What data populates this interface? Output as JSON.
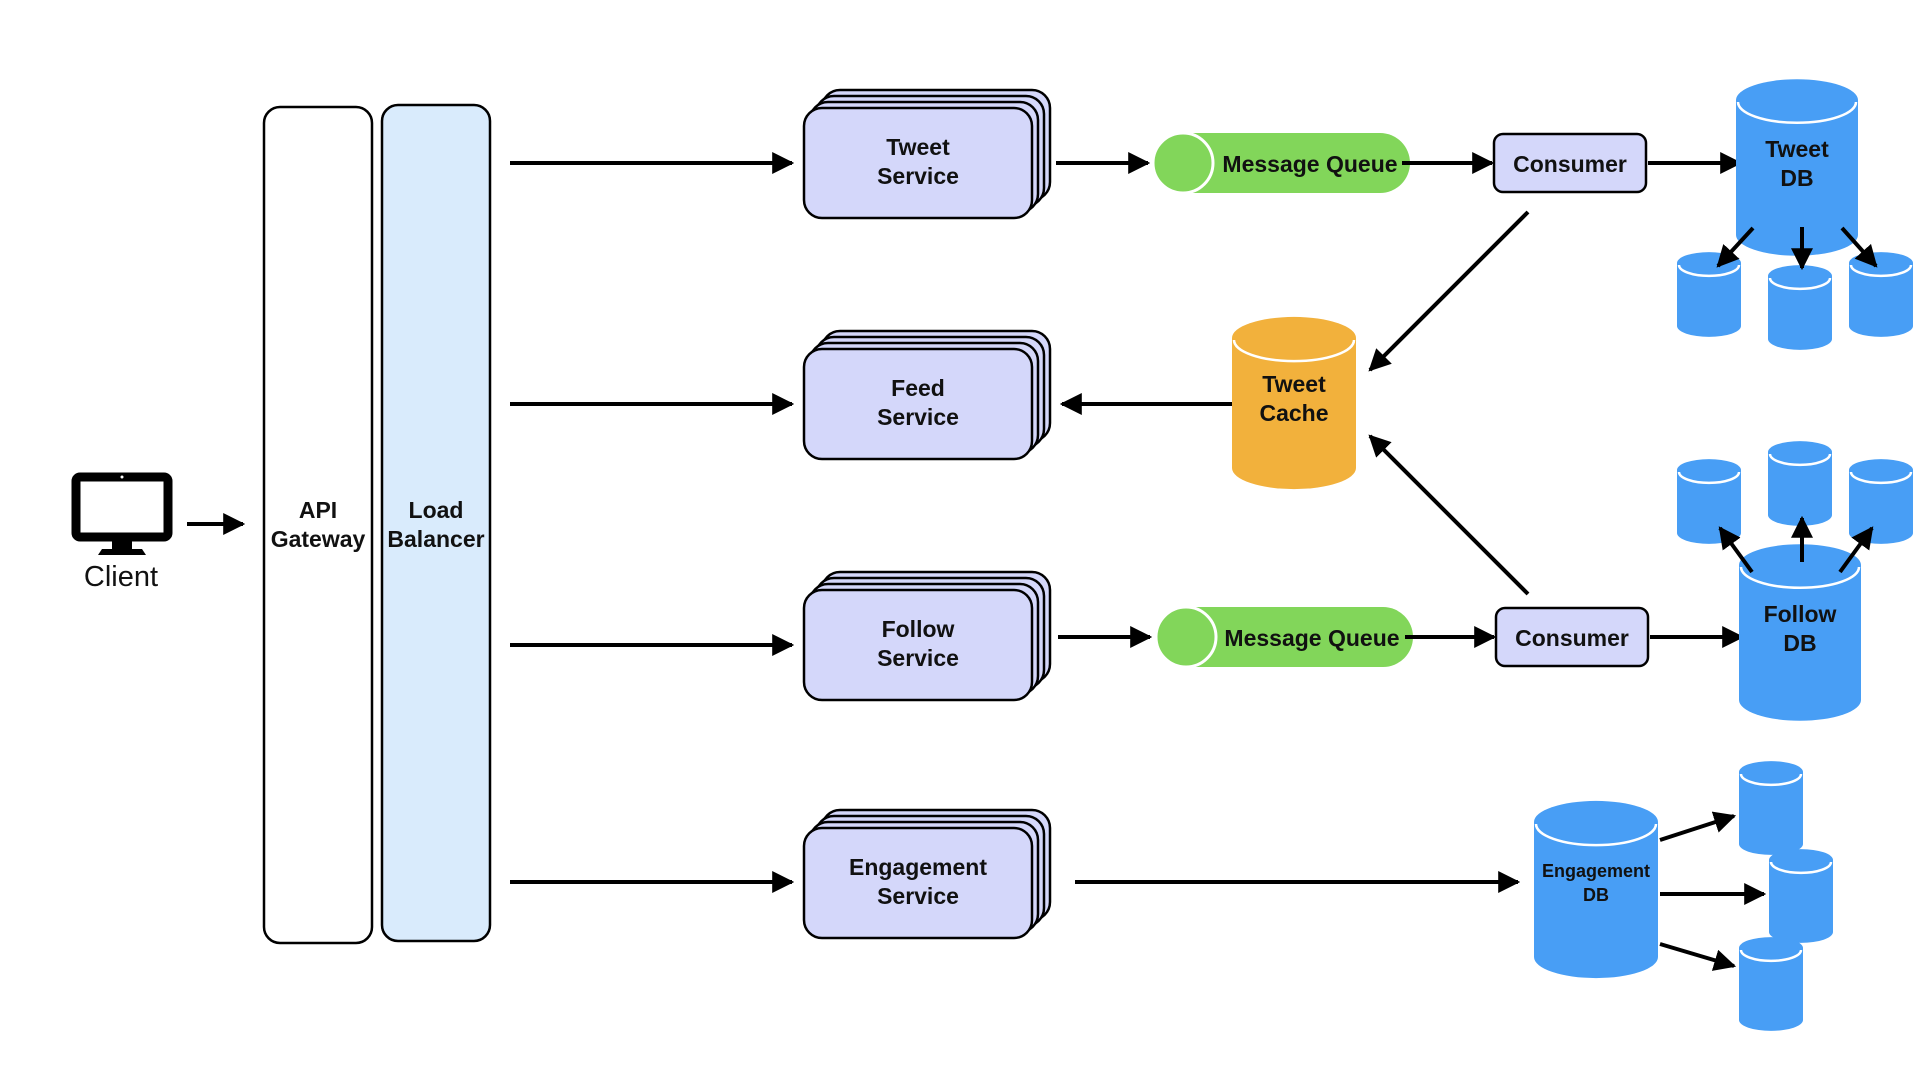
{
  "diagram": {
    "type": "system-architecture",
    "colors": {
      "service_fill": "#d4d7fa",
      "load_balancer_fill": "#d9ebfc",
      "queue_fill": "#82d65a",
      "cache_fill": "#f2b13c",
      "db_fill": "#489ef5",
      "stroke": "#000000"
    },
    "client": {
      "label": "Client",
      "icon": "monitor-icon"
    },
    "gateway": {
      "label_line1": "API",
      "label_line2": "Gateway"
    },
    "load_balancer": {
      "label_line1": "Load",
      "label_line2": "Balancer"
    },
    "services": [
      {
        "id": "tweet",
        "line1": "Tweet",
        "line2": "Service"
      },
      {
        "id": "feed",
        "line1": "Feed",
        "line2": "Service"
      },
      {
        "id": "follow",
        "line1": "Follow",
        "line2": "Service"
      },
      {
        "id": "engagement",
        "line1": "Engagement",
        "line2": "Service"
      }
    ],
    "queues": [
      {
        "id": "tweet-queue",
        "label": "Message Queue"
      },
      {
        "id": "follow-queue",
        "label": "Message Queue"
      }
    ],
    "consumers": [
      {
        "id": "tweet-consumer",
        "label": "Consumer"
      },
      {
        "id": "follow-consumer",
        "label": "Consumer"
      }
    ],
    "cache": {
      "line1": "Tweet",
      "line2": "Cache"
    },
    "databases": [
      {
        "id": "tweet-db",
        "line1": "Tweet",
        "line2": "DB",
        "replicas": 3
      },
      {
        "id": "follow-db",
        "line1": "Follow",
        "line2": "DB",
        "replicas": 3
      },
      {
        "id": "engagement-db",
        "line1": "Engagement",
        "line2": "DB",
        "replicas": 3
      }
    ],
    "edges": [
      {
        "from": "client",
        "to": "api-gateway"
      },
      {
        "from": "load-balancer",
        "to": "tweet-service"
      },
      {
        "from": "load-balancer",
        "to": "feed-service"
      },
      {
        "from": "load-balancer",
        "to": "follow-service"
      },
      {
        "from": "load-balancer",
        "to": "engagement-service"
      },
      {
        "from": "tweet-service",
        "to": "tweet-queue"
      },
      {
        "from": "tweet-queue",
        "to": "tweet-consumer"
      },
      {
        "from": "tweet-consumer",
        "to": "tweet-db"
      },
      {
        "from": "tweet-consumer",
        "to": "tweet-cache"
      },
      {
        "from": "tweet-cache",
        "to": "feed-service"
      },
      {
        "from": "follow-service",
        "to": "follow-queue"
      },
      {
        "from": "follow-queue",
        "to": "follow-consumer"
      },
      {
        "from": "follow-consumer",
        "to": "follow-db"
      },
      {
        "from": "follow-consumer",
        "to": "tweet-cache"
      },
      {
        "from": "engagement-service",
        "to": "engagement-db"
      },
      {
        "from": "tweet-db",
        "to": "tweet-db-replicas"
      },
      {
        "from": "follow-db",
        "to": "follow-db-replicas"
      },
      {
        "from": "engagement-db",
        "to": "engagement-db-replicas"
      }
    ]
  }
}
